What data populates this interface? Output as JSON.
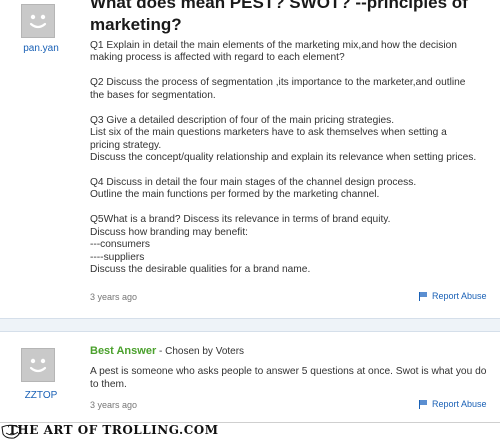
{
  "question": {
    "title_line1": "What does mean PEST? SWOT? --principles of",
    "title_line2": "marketing?",
    "username": "pan.yan",
    "lines": [
      "Q1 Explain in detail the main elements of the marketing mix,and how the decision",
      "making process is affected with regard to each element?",
      "",
      "Q2 Discuss the process of segmentation ,its importance to the marketer,and outline",
      "the bases for segmentation.",
      "",
      "Q3 Give a detailed description of four of the main pricing strategies.",
      "List six of the main questions marketers have to ask themselves when setting a",
      "pricing strategy.",
      "Discuss the concept/quality relationship and explain its relevance when setting prices.",
      "",
      "Q4 Discuss in detail the four main stages of the channel design process.",
      "Outline the main functions per formed by the marketing channel.",
      "",
      "Q5What is a brand? Discess its relevance in terms of brand equity.",
      "Discuss how branding may benefit:",
      "---consumers",
      "----suppliers",
      "Discuss the desirable qualities for a brand name."
    ],
    "time_ago": "3 years ago",
    "report_label": "Report Abuse"
  },
  "answer": {
    "username": "ZZTOP",
    "best_answer_label": "Best Answer",
    "chosen_by": " - Chosen by Voters",
    "text": "A pest is someone who asks people to answer 5 questions at once. Swot is what you do to them.",
    "time_ago": "3 years ago",
    "report_label": "Report Abuse"
  },
  "footer": {
    "watermark": "THE ART OF TROLLING.COM"
  },
  "colors": {
    "link": "#1a61b6",
    "best_answer": "#4aa02c",
    "avatar_bg": "#c9c9c9"
  },
  "icons": [
    "avatar-face-icon",
    "flag-icon",
    "troll-face-icon"
  ]
}
